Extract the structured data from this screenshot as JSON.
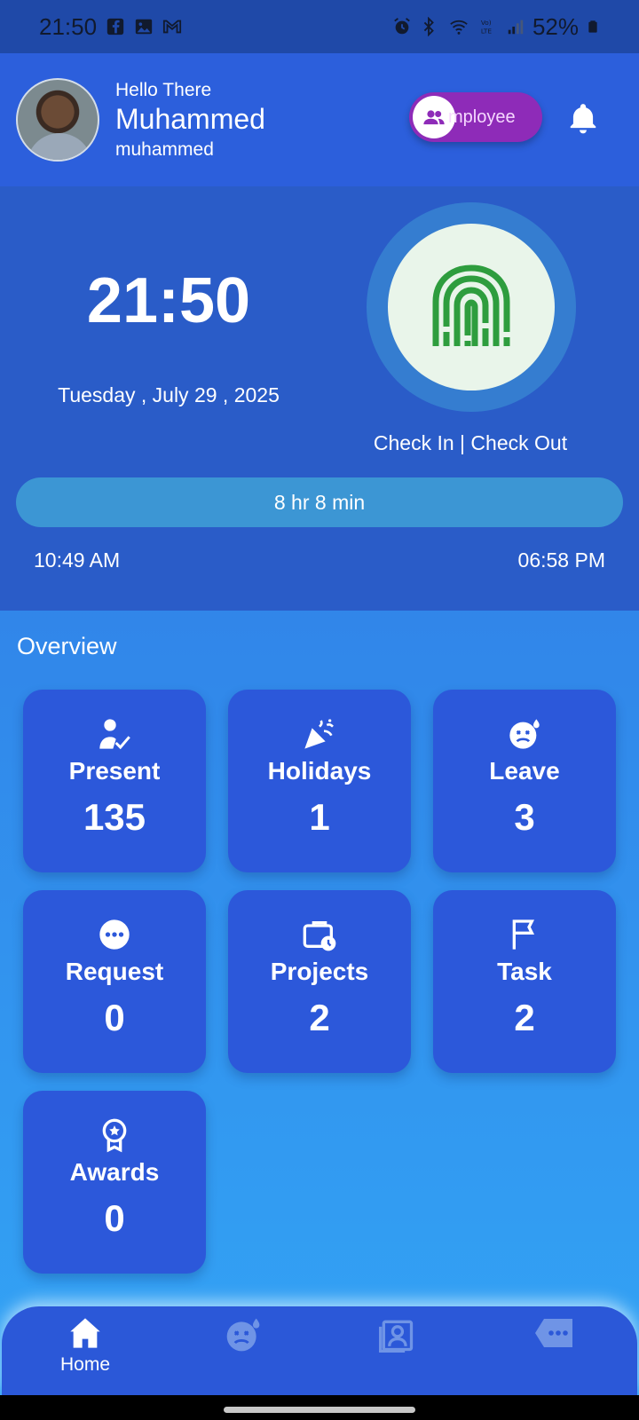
{
  "status_bar": {
    "time": "21:50",
    "battery": "52%",
    "left_icons": [
      "facebook-icon",
      "gallery-icon",
      "gmail-icon"
    ],
    "right_icons": [
      "alarm-icon",
      "bluetooth-icon",
      "wifi-icon",
      "volte-icon",
      "signal-icon",
      "battery-icon"
    ]
  },
  "header": {
    "greeting": "Hello There",
    "name": "Muhammed",
    "username": "muhammed",
    "role_label": "mployee"
  },
  "attendance": {
    "clock": "21:50",
    "date": "Tuesday , July 29 , 2025",
    "check_label": "Check In | Check Out",
    "duration": "8 hr 8 min",
    "check_in_time": "10:49 AM",
    "check_out_time": "06:58 PM"
  },
  "overview": {
    "title": "Overview",
    "cards": [
      {
        "label": "Present",
        "value": "135",
        "icon": "person-check-icon"
      },
      {
        "label": "Holidays",
        "value": "1",
        "icon": "party-popper-icon"
      },
      {
        "label": "Leave",
        "value": "3",
        "icon": "sick-face-icon"
      },
      {
        "label": "Request",
        "value": "0",
        "icon": "more-dots-icon"
      },
      {
        "label": "Projects",
        "value": "2",
        "icon": "briefcase-clock-icon"
      },
      {
        "label": "Task",
        "value": "2",
        "icon": "flag-icon"
      },
      {
        "label": "Awards",
        "value": "0",
        "icon": "award-icon"
      }
    ]
  },
  "bottom_nav": {
    "items": [
      {
        "label": "Home",
        "icon": "home-icon"
      },
      {
        "label": "",
        "icon": "sick-face-icon"
      },
      {
        "label": "",
        "icon": "id-card-icon"
      },
      {
        "label": "",
        "icon": "ticket-icon"
      }
    ]
  },
  "colors": {
    "header_bg": "#2c5fdc",
    "role_pill": "#8e2bb8",
    "card_bg": "#2c58da",
    "fingerprint_green": "#2e9d3e"
  }
}
